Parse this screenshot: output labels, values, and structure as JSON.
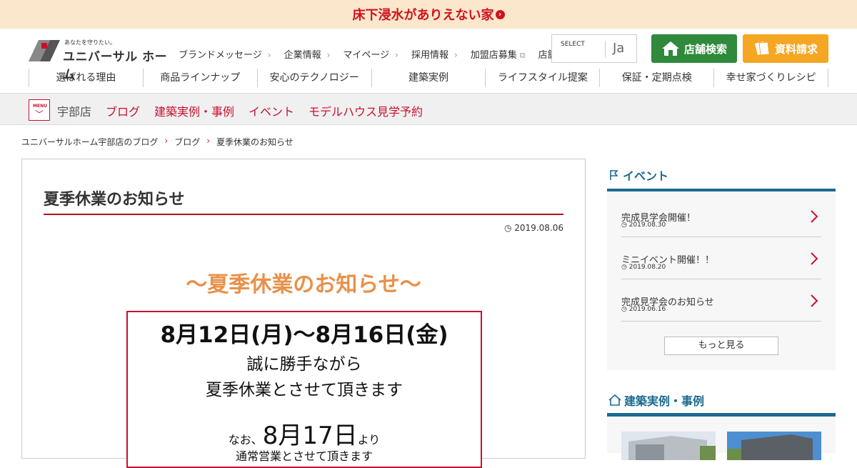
{
  "banner": {
    "text": "床下浸水がありえない家"
  },
  "logo": {
    "tagline": "あなたを守りたい。",
    "name": "ユニバーサル ホーム"
  },
  "subnav": {
    "items": [
      {
        "label": "ブランドメッセージ",
        "marker": "chevron"
      },
      {
        "label": "企業情報",
        "marker": "chevron"
      },
      {
        "label": "マイページ",
        "marker": "chevron"
      },
      {
        "label": "採用情報",
        "marker": "chevron"
      },
      {
        "label": "加盟店募集",
        "marker": "external"
      },
      {
        "label": "店舗採用情報",
        "marker": "external"
      }
    ]
  },
  "language": {
    "select_label": "SELECT",
    "current": "Ja"
  },
  "buttons": {
    "store_search": "店舗検索",
    "request_docs": "資料請求"
  },
  "mainnav": {
    "items": [
      {
        "label": "選ばれる理由"
      },
      {
        "label": "商品ラインナップ"
      },
      {
        "label": "安心のテクノロジー"
      },
      {
        "label": "建築実例"
      },
      {
        "label": "ライフスタイル提案"
      },
      {
        "label": "保証・定期点検"
      },
      {
        "label": "幸せ家づくりレシピ"
      }
    ]
  },
  "storebar": {
    "menu_label": "MENU",
    "store_name": "宇部店",
    "links": [
      {
        "label": "ブログ"
      },
      {
        "label": "建築実例・事例"
      },
      {
        "label": "イベント"
      },
      {
        "label": "モデルハウス見学予約"
      }
    ]
  },
  "breadcrumb": {
    "items": [
      {
        "label": "ユニバーサルホーム宇部店のブログ"
      },
      {
        "label": "ブログ"
      },
      {
        "label": "夏季休業のお知らせ"
      }
    ]
  },
  "article": {
    "title": "夏季休業のお知らせ",
    "date": "2019.08.06",
    "notice": {
      "heading": "～夏季休業のお知らせ～",
      "dates": "8月12日(月)～8月16日(金)",
      "line2": "誠に勝手ながら",
      "line3": "夏季休業とさせて頂きます",
      "pre": "なお、",
      "reopen_date": "8月17日",
      "post": "より",
      "line5": "通常営業とさせて頂きます"
    }
  },
  "sidebar": {
    "events_title": "イベント",
    "events": [
      {
        "title": "完成見学会開催！",
        "date": "2019.08.30"
      },
      {
        "title": "ミニイベント開催！！",
        "date": "2019.08.20"
      },
      {
        "title": "完成見学会のお知らせ",
        "date": "2019.06.16"
      }
    ],
    "more_label": "もっと見る",
    "works_title": "建築実例・事例"
  },
  "colors": {
    "accent_red": "#c8102e",
    "banner_bg": "#fbe7cc",
    "sidebar_blue": "#1c6a90",
    "store_green": "#2f8a3b",
    "doc_orange": "#f5a623",
    "notice_orange": "#e8914a"
  }
}
